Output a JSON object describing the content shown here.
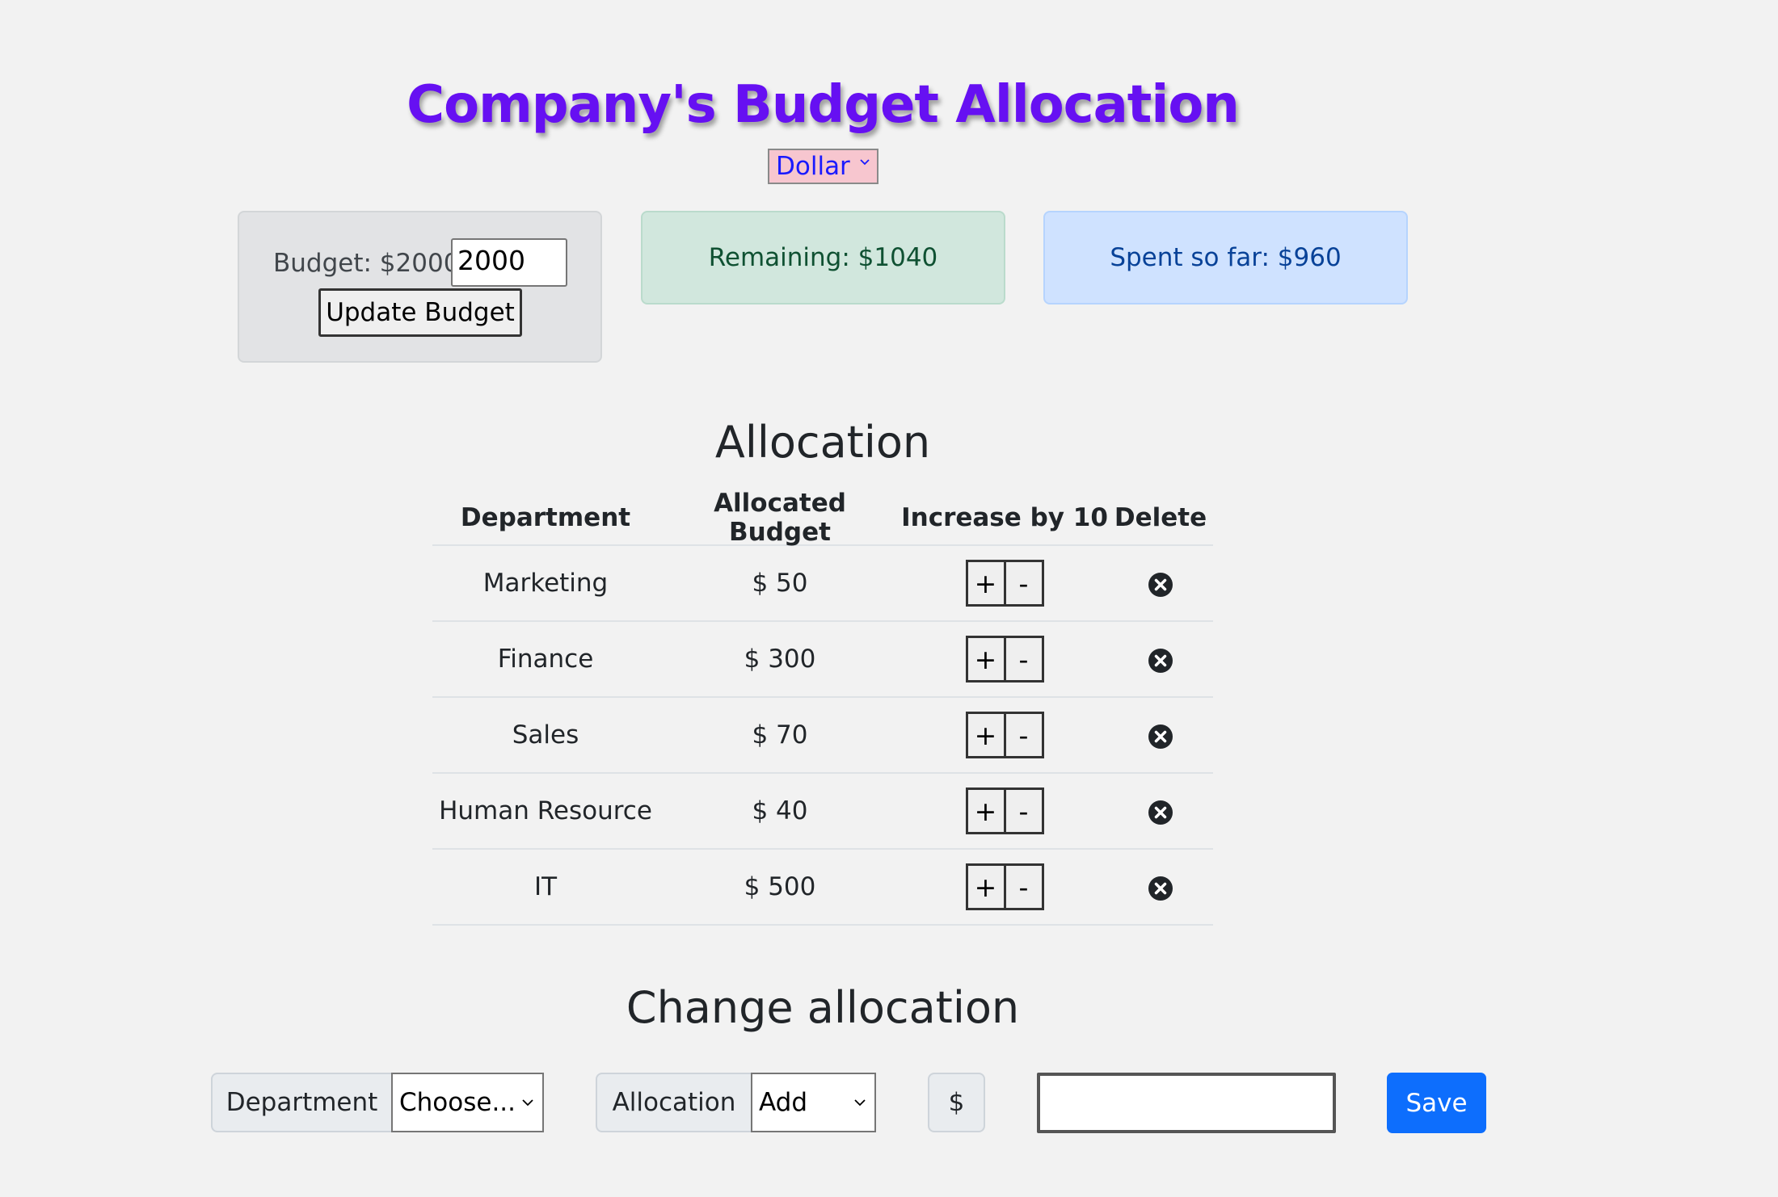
{
  "header": {
    "title": "Company's Budget Allocation",
    "currency_selected": "Dollar"
  },
  "budget_card": {
    "label": "Budget: $2000",
    "input_value": "2000",
    "update_label": "Update Budget"
  },
  "remaining_card": {
    "text": "Remaining: $1040"
  },
  "spent_card": {
    "text": "Spent so far: $960"
  },
  "allocation": {
    "heading": "Allocation",
    "columns": [
      "Department",
      "Allocated Budget",
      "Increase by 10",
      "Delete"
    ],
    "rows": [
      {
        "department": "Marketing",
        "budget": "$ 50"
      },
      {
        "department": "Finance",
        "budget": "$ 300"
      },
      {
        "department": "Sales",
        "budget": "$ 70"
      },
      {
        "department": "Human Resource",
        "budget": "$ 40"
      },
      {
        "department": "IT",
        "budget": "$ 500"
      }
    ],
    "plus_label": "+",
    "minus_label": "-"
  },
  "change_allocation": {
    "heading": "Change allocation",
    "department_label": "Department",
    "department_selected": "Choose...",
    "allocation_label": "Allocation",
    "allocation_selected": "Add",
    "currency_symbol": "$",
    "amount_value": "",
    "save_label": "Save"
  },
  "colors": {
    "title": "#6610f2",
    "currency_bg": "#f7c6cf",
    "budget_card_bg": "#e2e3e5",
    "remaining_card_bg": "#d1e7dd",
    "spent_card_bg": "#cfe2ff",
    "save_button_bg": "#0d6efd"
  },
  "icons": {
    "currency_dropdown": "chevron-down-icon",
    "delete": "x-circle-icon"
  }
}
